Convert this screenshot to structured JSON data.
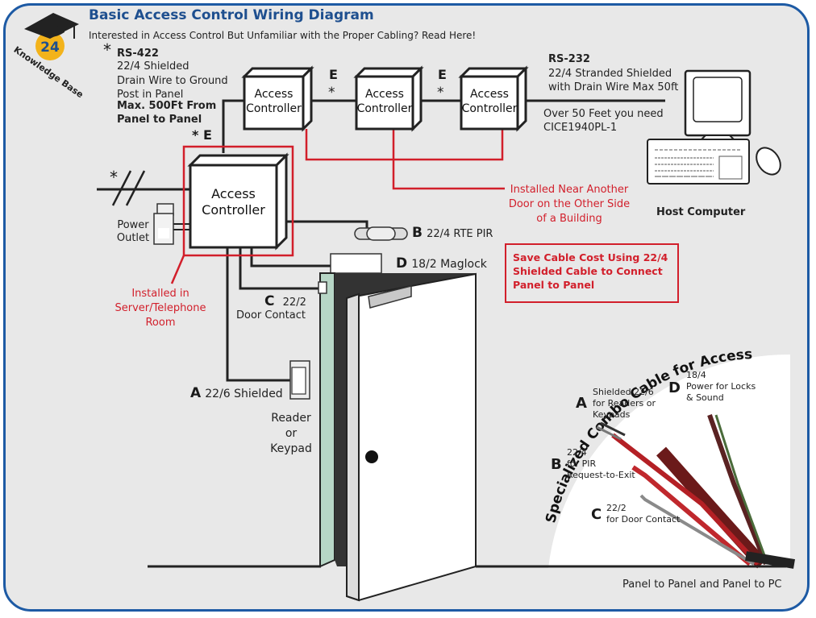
{
  "header": {
    "title": "Basic Access Control Wiring Diagram",
    "subtitle": "Interested in Access Control But Unfamiliar with the Proper Cabling? Read Here!",
    "logo": {
      "number": "24",
      "text": "Knowledge Base",
      "icon": "graduation-cap-icon"
    }
  },
  "controllers": {
    "main_line1": "Access",
    "main_line2": "Controller",
    "c1_line1": "Access",
    "c1_line2": "Controller",
    "c2_line1": "Access",
    "c2_line1b": "Access",
    "c2_line2": "Controller",
    "c3_line1": "Access",
    "c3_line2": "Controller"
  },
  "rs422": {
    "asterisk": "*",
    "title": "RS-422",
    "line1": "22/4 Shielded",
    "line2": "Drain Wire to Ground",
    "line3": "Post in Panel",
    "bold1": "Max. 500Ft From",
    "bold2": "Panel to Panel"
  },
  "markers": {
    "e": "E",
    "asterisk": "*",
    "star_e": "* E"
  },
  "rs232": {
    "title": "RS-232",
    "line1": "22/4 Stranded Shielded",
    "line2": "with Drain Wire Max 50ft",
    "note1": "Over 50 Feet you need",
    "note2": "CICE1940PL-1"
  },
  "host_computer": "Host Computer",
  "remote_note": {
    "line1": "Installed Near Another",
    "line2": "Door on the Other Side",
    "line3": "of a Building"
  },
  "power_outlet": {
    "line1": "Power",
    "line2": "Outlet"
  },
  "server_note": {
    "line1": "Installed in",
    "line2": "Server/Telephone",
    "line3": "Room"
  },
  "wires": {
    "b_letter": "B",
    "b_text": "22/4 RTE PIR",
    "d_letter": "D",
    "d_text": "18/2 Maglock",
    "c_letter": "C",
    "c_text": "22/2",
    "c_text2": "Door Contact",
    "a_letter": "A",
    "a_text": "22/6 Shielded"
  },
  "reader": {
    "line1": "Reader",
    "line2": "or",
    "line3": "Keypad"
  },
  "callout": {
    "text": "Save Cable Cost Using 22/4 Shielded Cable to Connect Panel to Panel"
  },
  "combo_cable": {
    "title": "Specialized Combo Cable for Access Control",
    "a_letter": "A",
    "a_line1": "Shielded 22/6",
    "a_line2": "for Readers or",
    "a_line3": "Keypads",
    "d_letter": "D",
    "d_line1": "18/4",
    "d_line2": "Power for Locks",
    "d_line3": "& Sound",
    "b_letter": "B",
    "b_line1": "22/4",
    "b_line2": "for PIR",
    "b_line3": "Request-to-Exit",
    "c_letter": "C",
    "c_line1": "22/2",
    "c_line2": "for Door Contact",
    "footer": "Panel to Panel and Panel to PC"
  },
  "colors": {
    "frame": "#1d5aa4",
    "title": "#1e4f8f",
    "accent_red": "#d21f2b",
    "background": "#e8e8e8"
  }
}
